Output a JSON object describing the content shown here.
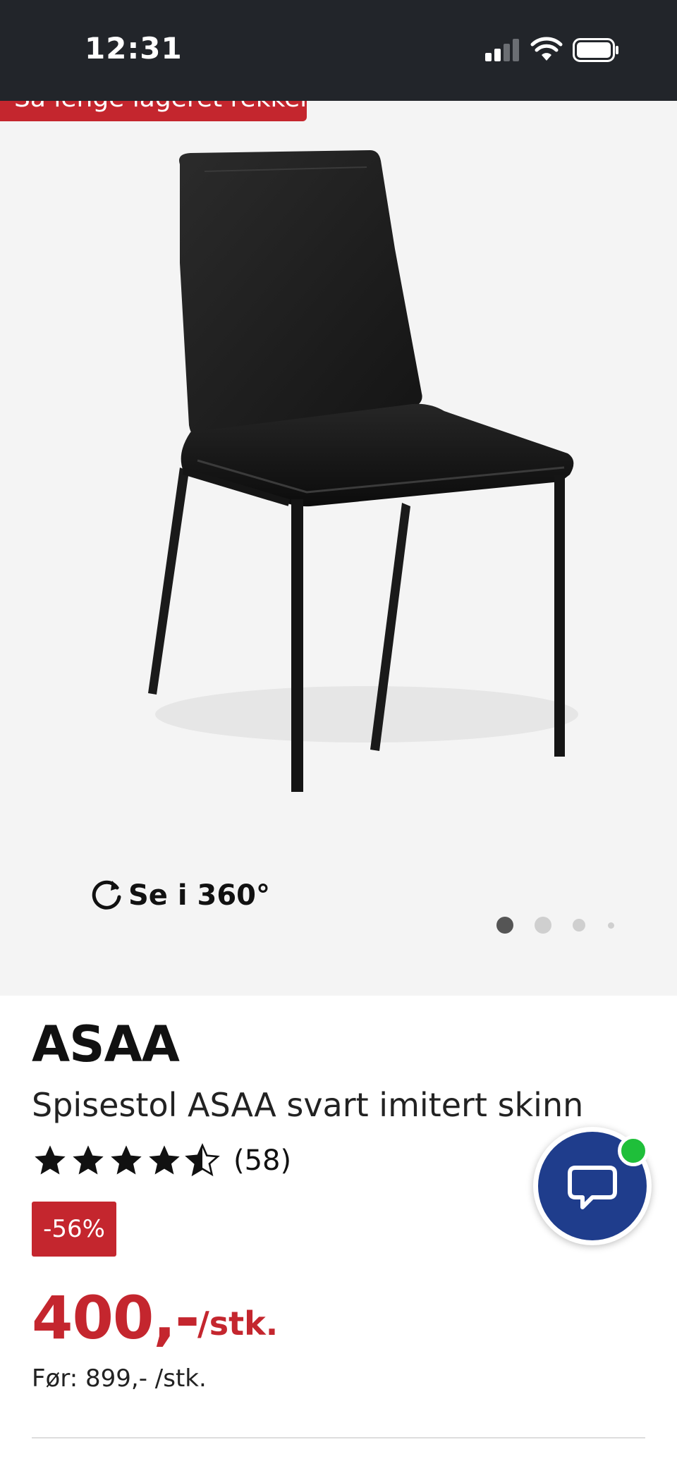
{
  "status_bar": {
    "time": "12:31",
    "signal_icon": "cellular-signal-icon",
    "wifi_icon": "wifi-icon",
    "battery_icon": "battery-icon"
  },
  "gallery": {
    "promo_banner": "Så lenge lageret rekker",
    "view_360_label": "Se i 360°",
    "view_360_icon": "rotate-icon",
    "dots_count": 4,
    "active_dot": 0
  },
  "product": {
    "brand": "ASAA",
    "name": "Spisestol ASAA svart imitert skinn",
    "rating_value": 4.5,
    "rating_max": 5,
    "rating_count": "(58)",
    "discount": "-56%",
    "price": "400,-",
    "unit": "/stk.",
    "old_price": "Før: 899,- /stk."
  },
  "chat": {
    "icon": "chat-bubble-icon",
    "status": "online"
  },
  "colors": {
    "accent": "#c4262e",
    "status_bar_bg": "#22252a",
    "chat_blue": "#1f3d8c",
    "online_green": "#1fbf3a",
    "image_bg": "#f4f4f4"
  }
}
